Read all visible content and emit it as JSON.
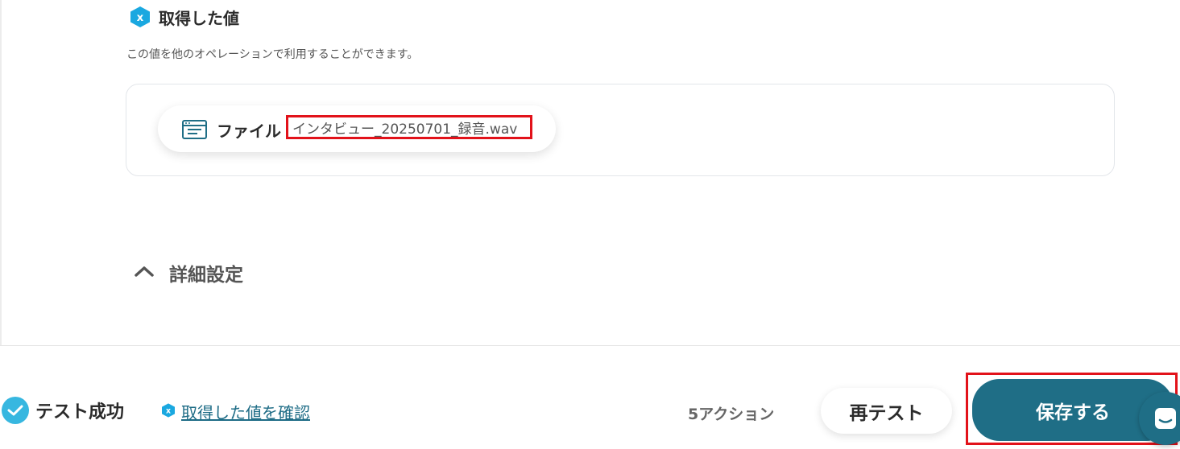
{
  "section": {
    "title": "取得した値",
    "description": "この値を他のオペレーションで利用することができます。"
  },
  "file_chip": {
    "label": "ファイル",
    "value": "インタビュー_20250701_録音.wav"
  },
  "details": {
    "label": "詳細設定"
  },
  "footer": {
    "status": "テスト成功",
    "view_values_link": "取得した値を確認",
    "actions_count": "5アクション",
    "retest_button": "再テスト",
    "save_button": "保存する"
  },
  "colors": {
    "accent": "#1f6e86",
    "hex_badge": "#1aa8e0",
    "highlight": "#e2121a"
  },
  "icons": [
    "hex-badge-icon",
    "file-window-icon",
    "chevron-up-icon",
    "check-icon",
    "chat-icon"
  ]
}
